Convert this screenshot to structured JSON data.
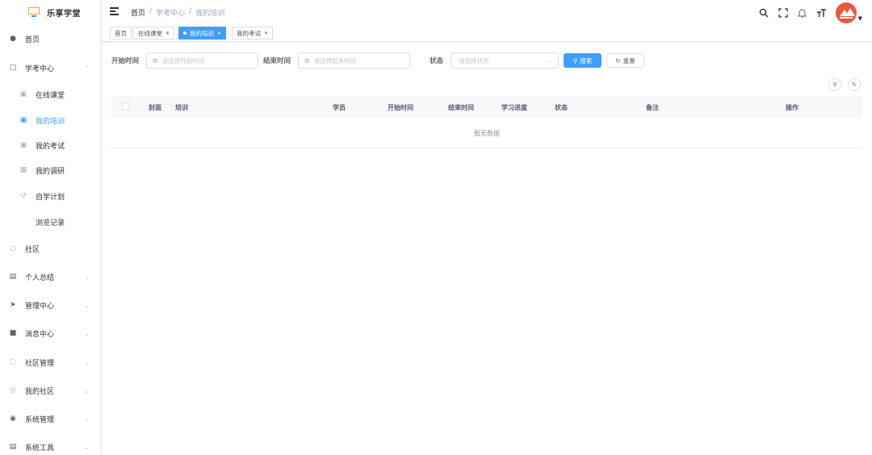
{
  "app": {
    "name": "乐享学堂"
  },
  "sidebar": {
    "items": [
      {
        "label": "首页",
        "icon": "dashboard-icon"
      },
      {
        "label": "学考中心",
        "icon": "monitor-icon",
        "expanded": true
      },
      {
        "label": "在线课堂",
        "icon": "classroom-icon"
      },
      {
        "label": "我的培训",
        "icon": "training-icon",
        "active": true
      },
      {
        "label": "我的考试",
        "icon": "exam-icon"
      },
      {
        "label": "我的调研",
        "icon": "survey-icon"
      },
      {
        "label": "自学计划",
        "icon": "plan-icon"
      },
      {
        "label": "浏览记录",
        "icon": ""
      },
      {
        "label": "社区",
        "icon": "community-icon"
      },
      {
        "label": "个人总结",
        "icon": "summary-icon"
      },
      {
        "label": "管理中心",
        "icon": "send-icon"
      },
      {
        "label": "消息中心",
        "icon": "message-icon"
      },
      {
        "label": "社区管理",
        "icon": "community-manage-icon"
      },
      {
        "label": "我的社区",
        "icon": "my-community-icon"
      },
      {
        "label": "系统管理",
        "icon": "settings-icon"
      },
      {
        "label": "系统工具",
        "icon": "tools-icon"
      }
    ]
  },
  "header": {
    "breadcrumb": [
      "首页",
      "学考中心",
      "我的培训"
    ],
    "separator": "/",
    "icons": [
      "search-icon",
      "fullscreen-icon",
      "bell-icon",
      "font-size-icon"
    ]
  },
  "tags": [
    {
      "label": "首页",
      "closable": false
    },
    {
      "label": "在线课堂",
      "closable": true
    },
    {
      "label": "我的培训",
      "closable": true,
      "active": true
    },
    {
      "label": "我的考试",
      "closable": true
    }
  ],
  "search": {
    "start_label": "开始时间",
    "start_placeholder": "请选择开始时间",
    "end_label": "结束时间",
    "end_placeholder": "请选择结束时间",
    "status_label": "状态",
    "status_placeholder": "请选择状态",
    "search_button": "搜索",
    "reset_button": "重置"
  },
  "table": {
    "columns": [
      "封面",
      "培训",
      "学员",
      "开始时间",
      "结束时间",
      "学习进度",
      "状态",
      "备注",
      "操作"
    ],
    "empty_text": "暂无数据"
  },
  "colors": {
    "primary": "#409eff",
    "avatar": "#e8573e"
  }
}
